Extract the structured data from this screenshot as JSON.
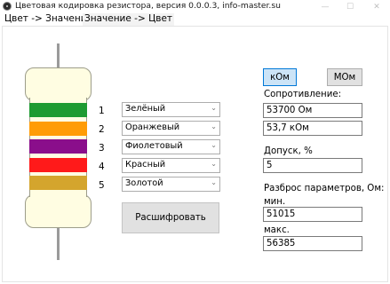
{
  "window": {
    "title": "Цветовая кодировка резистора, версия 0.0.0.3, info-master.su",
    "controls": {
      "minimize": "—",
      "maximize": "☐",
      "close": "✕"
    }
  },
  "tabs": [
    {
      "label": "Цвет -> Значение"
    },
    {
      "label": "Значение -> Цвет"
    }
  ],
  "bands": [
    {
      "number": "1",
      "color_name": "Зелёный",
      "color": "#1e9b32"
    },
    {
      "number": "2",
      "color_name": "Оранжевый",
      "color": "#ff9c06"
    },
    {
      "number": "3",
      "color_name": "Фиолетовый",
      "color": "#8a0e8b"
    },
    {
      "number": "4",
      "color_name": "Красный",
      "color": "#ff1a1a"
    },
    {
      "number": "5",
      "color_name": "Золотой",
      "color": "#d4a52d"
    }
  ],
  "decode_button": "Расшифровать",
  "units": {
    "kohm": "кОм",
    "mohm": "МОм"
  },
  "resistance": {
    "label": "Сопротивление:",
    "value_ohm": "53700 Ом",
    "value_kohm": "53,7 кОм"
  },
  "tolerance": {
    "label": "Допуск, %",
    "value": "5"
  },
  "spread": {
    "label": "Разброс параметров, Ом:",
    "min_label": "мин.",
    "min_value": "51015",
    "max_label": "макс.",
    "max_value": "56385"
  }
}
